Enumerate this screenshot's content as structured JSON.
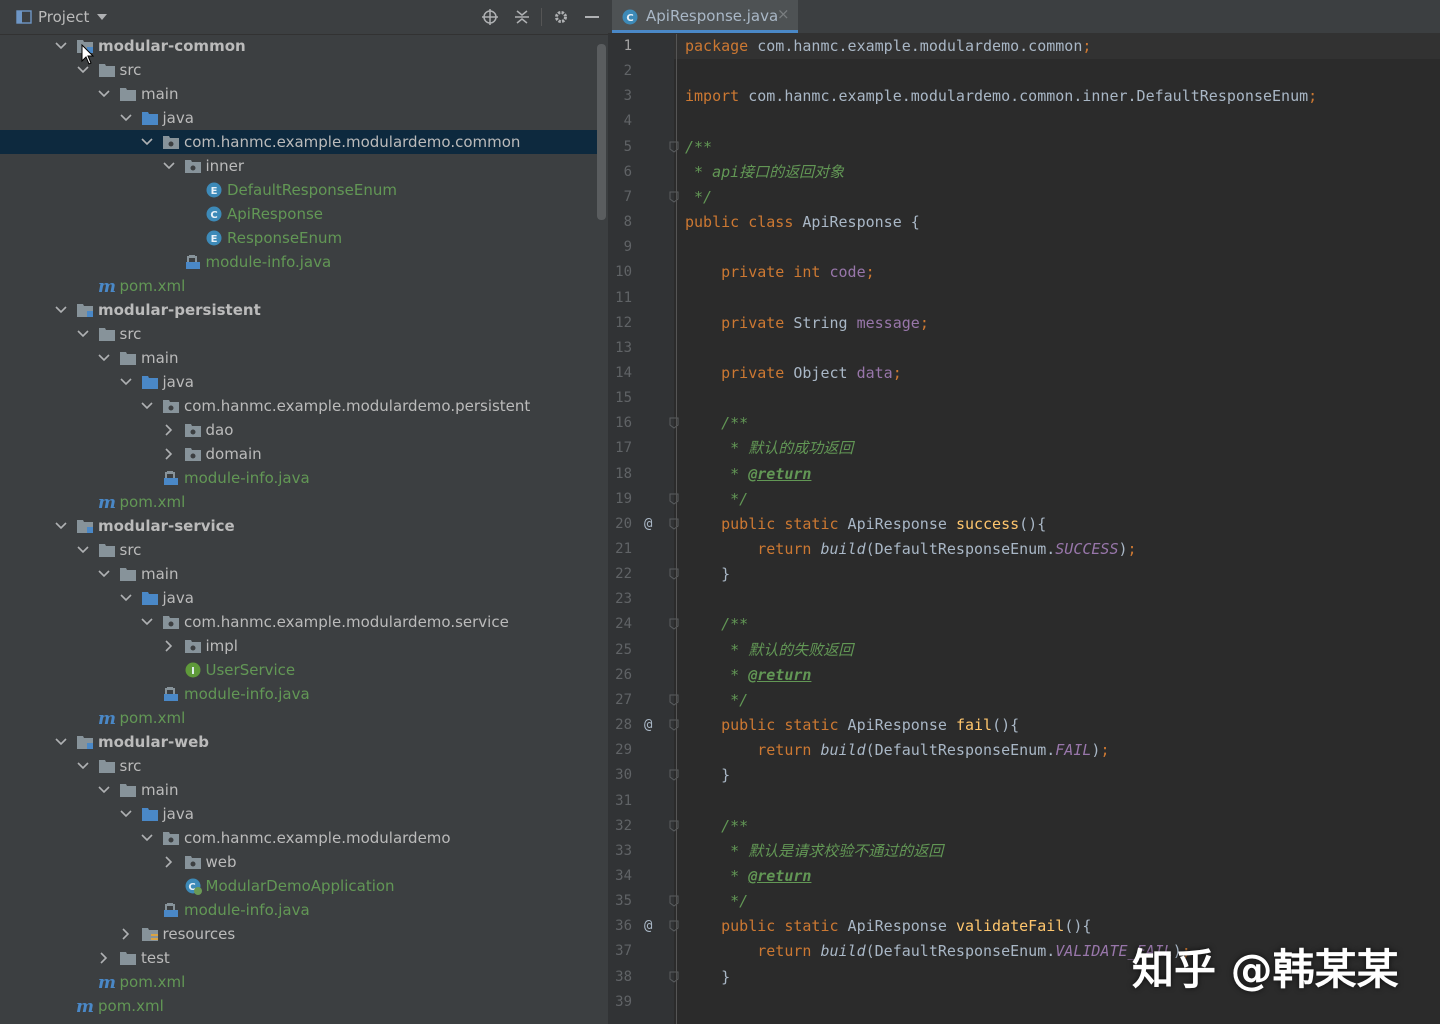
{
  "panel": {
    "title": "Project",
    "toolbar_icons": [
      "locate-icon",
      "collapse-all-icon",
      "gear-icon",
      "hide-icon"
    ]
  },
  "tree": [
    {
      "label": "modular-common",
      "icon": "module-folder",
      "expanded": true,
      "bold": true
    },
    {
      "label": "src",
      "icon": "folder",
      "expanded": true
    },
    {
      "label": "main",
      "icon": "folder",
      "expanded": true
    },
    {
      "label": "java",
      "icon": "source-folder",
      "expanded": true
    },
    {
      "label": "com.hanmc.example.modulardemo.common",
      "icon": "package",
      "expanded": true,
      "selected": true
    },
    {
      "label": "inner",
      "icon": "package",
      "expanded": true
    },
    {
      "label": "DefaultResponseEnum",
      "icon": "enum",
      "green": true
    },
    {
      "label": "ApiResponse",
      "icon": "class",
      "green": true
    },
    {
      "label": "ResponseEnum",
      "icon": "enum",
      "green": true
    },
    {
      "label": "module-info.java",
      "icon": "module-info",
      "green": true
    },
    {
      "label": "pom.xml",
      "icon": "maven",
      "green": true
    },
    {
      "label": "modular-persistent",
      "icon": "module-folder",
      "expanded": true,
      "bold": true
    },
    {
      "label": "src",
      "icon": "folder",
      "expanded": true
    },
    {
      "label": "main",
      "icon": "folder",
      "expanded": true
    },
    {
      "label": "java",
      "icon": "source-folder",
      "expanded": true
    },
    {
      "label": "com.hanmc.example.modulardemo.persistent",
      "icon": "package",
      "expanded": true
    },
    {
      "label": "dao",
      "icon": "package",
      "expanded": false
    },
    {
      "label": "domain",
      "icon": "package",
      "expanded": false
    },
    {
      "label": "module-info.java",
      "icon": "module-info",
      "green": true
    },
    {
      "label": "pom.xml",
      "icon": "maven",
      "green": true
    },
    {
      "label": "modular-service",
      "icon": "module-folder",
      "expanded": true,
      "bold": true
    },
    {
      "label": "src",
      "icon": "folder",
      "expanded": true
    },
    {
      "label": "main",
      "icon": "folder",
      "expanded": true
    },
    {
      "label": "java",
      "icon": "source-folder",
      "expanded": true
    },
    {
      "label": "com.hanmc.example.modulardemo.service",
      "icon": "package",
      "expanded": true
    },
    {
      "label": "impl",
      "icon": "package",
      "expanded": false
    },
    {
      "label": "UserService",
      "icon": "interface",
      "green": true
    },
    {
      "label": "module-info.java",
      "icon": "module-info",
      "green": true
    },
    {
      "label": "pom.xml",
      "icon": "maven",
      "green": true
    },
    {
      "label": "modular-web",
      "icon": "module-folder",
      "expanded": true,
      "bold": true
    },
    {
      "label": "src",
      "icon": "folder",
      "expanded": true
    },
    {
      "label": "main",
      "icon": "folder",
      "expanded": true
    },
    {
      "label": "java",
      "icon": "source-folder",
      "expanded": true
    },
    {
      "label": "com.hanmc.example.modulardemo",
      "icon": "package",
      "expanded": true
    },
    {
      "label": "web",
      "icon": "package",
      "expanded": false
    },
    {
      "label": "ModularDemoApplication",
      "icon": "spring-class",
      "green": true
    },
    {
      "label": "module-info.java",
      "icon": "module-info",
      "green": true
    },
    {
      "label": "resources",
      "icon": "resources-folder",
      "expanded": false
    },
    {
      "label": "test",
      "icon": "folder",
      "expanded": false
    },
    {
      "label": "pom.xml",
      "icon": "maven",
      "green": true
    },
    {
      "label": "pom.xml",
      "icon": "maven",
      "green": true
    }
  ],
  "editor": {
    "tab": {
      "label": "ApiResponse.java",
      "close": "×",
      "icon": "class-icon"
    },
    "annotation_mark": "@",
    "lines": [
      [
        [
          "kw",
          "package"
        ],
        [
          "t",
          " com.hanmc.example.modulardemo.common"
        ],
        [
          "kw",
          ";"
        ]
      ],
      [],
      [
        [
          "kw",
          "import"
        ],
        [
          "t",
          " com.hanmc.example.modulardemo.common.inner.DefaultResponseEnum"
        ],
        [
          "kw",
          ";"
        ]
      ],
      [],
      [
        [
          "cm",
          "/**"
        ]
      ],
      [
        [
          "cm",
          " * api接口的返回对象"
        ]
      ],
      [
        [
          "cm",
          " */"
        ]
      ],
      [
        [
          "kw",
          "public class"
        ],
        [
          "t",
          " ApiResponse {"
        ]
      ],
      [],
      [
        [
          "t",
          "    "
        ],
        [
          "kw",
          "private int"
        ],
        [
          "t",
          " "
        ],
        [
          "fld",
          "code"
        ],
        [
          "kw",
          ";"
        ]
      ],
      [],
      [
        [
          "t",
          "    "
        ],
        [
          "kw",
          "private"
        ],
        [
          "t",
          " String "
        ],
        [
          "fld",
          "message"
        ],
        [
          "kw",
          ";"
        ]
      ],
      [],
      [
        [
          "t",
          "    "
        ],
        [
          "kw",
          "private"
        ],
        [
          "t",
          " Object "
        ],
        [
          "fld",
          "data"
        ],
        [
          "kw",
          ";"
        ]
      ],
      [],
      [
        [
          "t",
          "    "
        ],
        [
          "cm",
          "/**"
        ]
      ],
      [
        [
          "t",
          "    "
        ],
        [
          "cm",
          " * 默认的成功返回"
        ]
      ],
      [
        [
          "t",
          "    "
        ],
        [
          "cm",
          " * "
        ],
        [
          "tag",
          "@return"
        ]
      ],
      [
        [
          "t",
          "    "
        ],
        [
          "cm",
          " */"
        ]
      ],
      [
        [
          "t",
          "    "
        ],
        [
          "kw",
          "public static"
        ],
        [
          "t",
          " ApiResponse "
        ],
        [
          "fn",
          "success"
        ],
        [
          "t",
          "(){"
        ]
      ],
      [
        [
          "t",
          "        "
        ],
        [
          "kw",
          "return"
        ],
        [
          "t",
          " "
        ],
        [
          "ital",
          "build"
        ],
        [
          "t",
          "(DefaultResponseEnum."
        ],
        [
          "cst",
          "SUCCESS"
        ],
        [
          "t",
          ")"
        ],
        [
          "kw",
          ";"
        ]
      ],
      [
        [
          "t",
          "    }"
        ]
      ],
      [],
      [
        [
          "t",
          "    "
        ],
        [
          "cm",
          "/**"
        ]
      ],
      [
        [
          "t",
          "    "
        ],
        [
          "cm",
          " * 默认的失败返回"
        ]
      ],
      [
        [
          "t",
          "    "
        ],
        [
          "cm",
          " * "
        ],
        [
          "tag",
          "@return"
        ]
      ],
      [
        [
          "t",
          "    "
        ],
        [
          "cm",
          " */"
        ]
      ],
      [
        [
          "t",
          "    "
        ],
        [
          "kw",
          "public static"
        ],
        [
          "t",
          " ApiResponse "
        ],
        [
          "fn",
          "fail"
        ],
        [
          "t",
          "(){"
        ]
      ],
      [
        [
          "t",
          "        "
        ],
        [
          "kw",
          "return"
        ],
        [
          "t",
          " "
        ],
        [
          "ital",
          "build"
        ],
        [
          "t",
          "(DefaultResponseEnum."
        ],
        [
          "cst",
          "FAIL"
        ],
        [
          "t",
          ")"
        ],
        [
          "kw",
          ";"
        ]
      ],
      [
        [
          "t",
          "    }"
        ]
      ],
      [],
      [
        [
          "t",
          "    "
        ],
        [
          "cm",
          "/**"
        ]
      ],
      [
        [
          "t",
          "    "
        ],
        [
          "cm",
          " * 默认是请求校验不通过的返回"
        ]
      ],
      [
        [
          "t",
          "    "
        ],
        [
          "cm",
          " * "
        ],
        [
          "tag",
          "@return"
        ]
      ],
      [
        [
          "t",
          "    "
        ],
        [
          "cm",
          " */"
        ]
      ],
      [
        [
          "t",
          "    "
        ],
        [
          "kw",
          "public static"
        ],
        [
          "t",
          " ApiResponse "
        ],
        [
          "fn",
          "validateFail"
        ],
        [
          "t",
          "(){"
        ]
      ],
      [
        [
          "t",
          "        "
        ],
        [
          "kw",
          "return"
        ],
        [
          "t",
          " "
        ],
        [
          "ital",
          "build"
        ],
        [
          "t",
          "(DefaultResponseEnum."
        ],
        [
          "cst",
          "VALIDATE_FAIL"
        ],
        [
          "t",
          ")"
        ],
        [
          "kw",
          ";"
        ]
      ],
      [
        [
          "t",
          "    }"
        ]
      ],
      []
    ],
    "current_line": 1,
    "annotation_lines": [
      20,
      28,
      36
    ],
    "fold_lines": [
      5,
      7,
      16,
      19,
      20,
      22,
      24,
      27,
      28,
      30,
      32,
      35,
      36,
      38
    ]
  },
  "watermark": "知乎 @韩某某",
  "colors": {
    "panel_bg": "#3c3f41",
    "editor_bg": "#2b2b2b",
    "selection": "#0d293e",
    "keyword": "#cc7832",
    "comment": "#629755",
    "method": "#ffc66d",
    "field": "#9876aa",
    "text": "#a9b7c6"
  }
}
